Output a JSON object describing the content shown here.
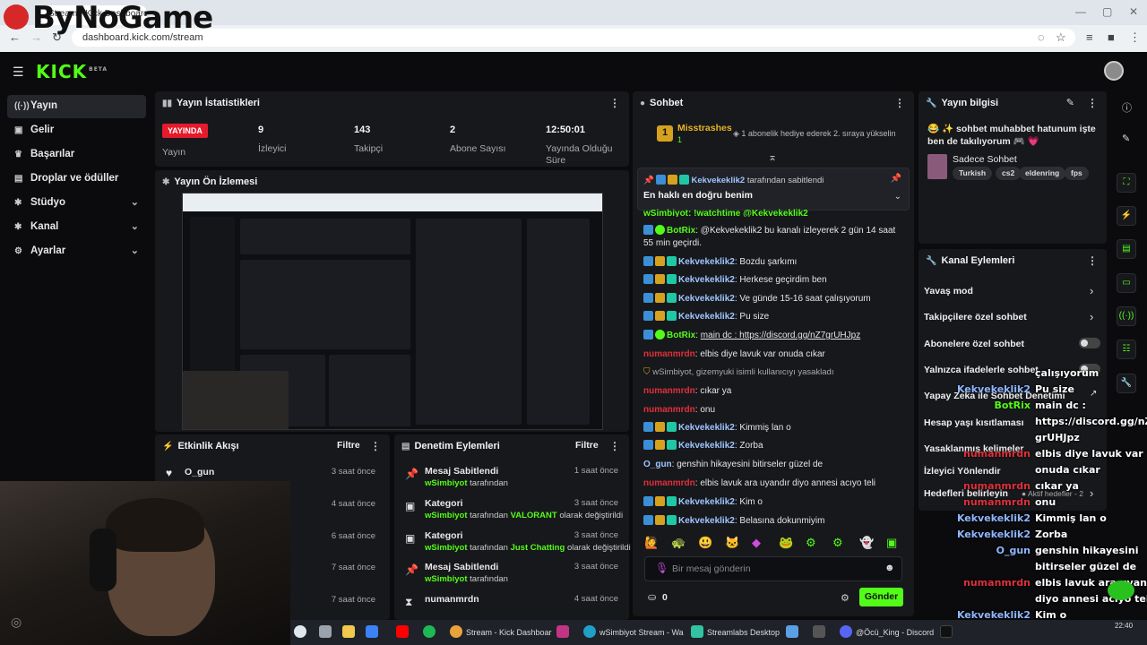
{
  "browser": {
    "tab_title": "Stream - Kick Dashboard",
    "url": "dashboard.kick.com/stream",
    "overlay_logo": "ByNoGame"
  },
  "brand": {
    "logo": "KICK",
    "beta": "BETA",
    "accent": "#53fc18"
  },
  "sidebar": {
    "items": [
      {
        "label": "Yayın",
        "icon": "broadcast-icon",
        "active": true
      },
      {
        "label": "Gelir",
        "icon": "wallet-icon"
      },
      {
        "label": "Başarılar",
        "icon": "trophy-icon"
      },
      {
        "label": "Droplar ve ödüller",
        "icon": "gift-icon"
      },
      {
        "label": "Stüdyo",
        "icon": "studio-icon",
        "expand": true
      },
      {
        "label": "Kanal",
        "icon": "channel-icon",
        "expand": true
      },
      {
        "label": "Ayarlar",
        "icon": "gear-icon",
        "expand": true
      }
    ]
  },
  "stats": {
    "title": "Yayın İstatistikleri",
    "live_badge": "YAYINDA",
    "live_label": "Yayın",
    "viewers": "9",
    "viewers_label": "İzleyici",
    "followers": "143",
    "followers_label": "Takipçi",
    "subs": "2",
    "subs_label": "Abone Sayısı",
    "uptime": "12:50:01",
    "uptime_label": "Yayında Olduğu Süre"
  },
  "preview": {
    "title": "Yayın Ön İzlemesi"
  },
  "activity": {
    "title": "Etkinlik Akışı",
    "filter": "Filtre",
    "rows": [
      {
        "name": "O_gun",
        "time": "3 saat önce"
      },
      {
        "name": "",
        "time": "4 saat önce"
      },
      {
        "name": "",
        "time": "6 saat önce"
      },
      {
        "name": "",
        "time": "7 saat önce"
      },
      {
        "name": "",
        "time": "7 saat önce"
      }
    ]
  },
  "moderation": {
    "title": "Denetim Eylemleri",
    "filter": "Filtre",
    "rows": [
      {
        "icon": "pin-icon",
        "title": "Mesaj Sabitlendi",
        "time": "1 saat önce",
        "user": "wSimbiyot",
        "sub": "tarafından",
        "extra": "",
        "tail": ""
      },
      {
        "icon": "category-icon",
        "title": "Kategori",
        "time": "3 saat önce",
        "user": "wSimbiyot",
        "sub": "tarafından",
        "extra": "VALORANT",
        "tail": "olarak değiştirildi"
      },
      {
        "icon": "category-icon",
        "title": "Kategori",
        "time": "3 saat önce",
        "user": "wSimbiyot",
        "sub": "tarafından",
        "extra": "Just Chatting",
        "tail": "olarak değiştirildi"
      },
      {
        "icon": "pin-icon",
        "title": "Mesaj Sabitlendi",
        "time": "3 saat önce",
        "user": "wSimbiyot",
        "sub": "tarafından",
        "extra": "",
        "tail": ""
      },
      {
        "icon": "hourglass-icon",
        "title": "numanmrdn",
        "time": "4 saat önce",
        "user": "",
        "sub": "",
        "extra": "",
        "tail": ""
      }
    ]
  },
  "chat": {
    "title": "Sohbet",
    "top_gifter": "Misstrashes",
    "top_gifter_count": "1",
    "gift_text": "1 abonelik hediye ederek 2. sıraya yükselin",
    "pinned_by_user": "Kekvekeklik2",
    "pinned_by_text": "tarafından sabitlendi",
    "pinned_message": "En haklı en doğru benim",
    "partial_top": "wSimbiyot: !watchtime @Kekvekeklik2",
    "messages": [
      {
        "user": "BotRix",
        "color": "green",
        "text": "@Kekvekeklik2 bu kanalı izleyerek 2 gün 14 saat 55 min geçirdi.",
        "badges": [
          "b-blue",
          "b-green"
        ]
      },
      {
        "user": "Kekvekeklik2",
        "color": "blue",
        "text": "Bozdu şarkımı",
        "badges": [
          "b-blue",
          "b-gold",
          "b-teal"
        ]
      },
      {
        "user": "Kekvekeklik2",
        "color": "blue",
        "text": "Herkese geçirdim ben",
        "badges": [
          "b-blue",
          "b-gold",
          "b-teal"
        ]
      },
      {
        "user": "Kekvekeklik2",
        "color": "blue",
        "text": "Ve günde 15-16 saat çalışıyorum",
        "badges": [
          "b-blue",
          "b-gold",
          "b-teal"
        ]
      },
      {
        "user": "Kekvekeklik2",
        "color": "blue",
        "text": "Pu size",
        "badges": [
          "b-blue",
          "b-gold",
          "b-teal"
        ]
      },
      {
        "user": "BotRix",
        "color": "green",
        "text": "main dc : https://discord.gg/nZ7grUHJpz",
        "badges": [
          "b-blue",
          "b-green"
        ]
      },
      {
        "user": "numanmrdn",
        "color": "red",
        "text": "elbis diye lavuk var onuda cıkar",
        "badges": []
      },
      {
        "user": "",
        "color": "",
        "text": "wSimbiyot, gizemyuki isimli kullanıcıyı yasakladı",
        "badges": [],
        "system": true
      },
      {
        "user": "numanmrdn",
        "color": "red",
        "text": "cıkar ya",
        "badges": []
      },
      {
        "user": "numanmrdn",
        "color": "red",
        "text": "onu",
        "badges": []
      },
      {
        "user": "Kekvekeklik2",
        "color": "blue",
        "text": "Kimmiş lan o",
        "badges": [
          "b-blue",
          "b-gold",
          "b-teal"
        ]
      },
      {
        "user": "Kekvekeklik2",
        "color": "blue",
        "text": "Zorba",
        "badges": [
          "b-blue",
          "b-gold",
          "b-teal"
        ]
      },
      {
        "user": "O_gun",
        "color": "blue",
        "text": "genshin hikayesini bitirseler güzel de",
        "badges": []
      },
      {
        "user": "numanmrdn",
        "color": "red",
        "text": "elbis lavuk ara uyandır diyo annesi acıyo teli",
        "badges": []
      },
      {
        "user": "Kekvekeklik2",
        "color": "blue",
        "text": "Kim o",
        "badges": [
          "b-blue",
          "b-gold",
          "b-teal"
        ]
      },
      {
        "user": "Kekvekeklik2",
        "color": "blue",
        "text": "Belasına dokunmiyim",
        "badges": [
          "b-blue",
          "b-gold",
          "b-teal"
        ]
      }
    ],
    "input_placeholder": "Bir mesaj gönderin",
    "points": "0",
    "send": "Gönder"
  },
  "stream_info": {
    "title": "Yayın bilgisi",
    "stream_title": "😂 ✨ sohbet muhabbet hatunum işte ben de takılıyorum 🎮 💗",
    "category": "Sadece Sohbet",
    "tags": [
      "Turkish",
      "cs2",
      "eldenring",
      "fps"
    ]
  },
  "channel_actions": {
    "title": "Kanal Eylemleri",
    "rows": [
      {
        "label": "Yavaş mod",
        "control": "chevron"
      },
      {
        "label": "Takipçilere özel sohbet",
        "control": "chevron"
      },
      {
        "label": "Abonelere özel sohbet",
        "control": "toggle"
      },
      {
        "label": "Yalnızca ifadelerle sohbet",
        "control": "toggle"
      },
      {
        "label": "Yapay Zeka ile Sohbet Denetimi",
        "control": "external"
      },
      {
        "label": "Hesap yaşı kısıtlaması",
        "control": "chevron"
      },
      {
        "label": "Yasaklanmış kelimeler",
        "control": "chevron"
      },
      {
        "label": "İzleyici Yönlendir",
        "control": "chevron"
      },
      {
        "label": "Hedefleri belirleyin",
        "control": "chevron",
        "extra": "Aktif hedefler - 2"
      }
    ]
  },
  "overlay_chat": {
    "names": [
      "Kekvekeklik2",
      "BotRix",
      "",
      "",
      "numanmrdn",
      "",
      "numanmrdn",
      "numanmrdn",
      "Kekvekeklik2",
      "Kekvekeklik2",
      "O_gun",
      "",
      "numanmrdn",
      "",
      "Kekvekeklik2",
      "Kekvekeklik2"
    ],
    "lines": [
      "çalışıyorum",
      "Pu size",
      "main dc :",
      "https://discord.gg/nZ7",
      "grUHJpz",
      "elbis diye lavuk var",
      "onuda cıkar",
      "cıkar ya",
      "onu",
      "Kimmiş lan o",
      "Zorba",
      "genshin hikayesini",
      "bitirseler güzel de",
      "elbis lavuk ara uyandır",
      "diyo annesi acıyo teli",
      "Kim o",
      "Belasına dokunmiyim"
    ]
  },
  "taskbar": {
    "items": [
      "Stream - Kick Dashboar",
      "wSimbiyot Stream - Wa",
      "Streamlabs Desktop",
      "@Öcü_King - Discord"
    ],
    "time": "22:40"
  }
}
